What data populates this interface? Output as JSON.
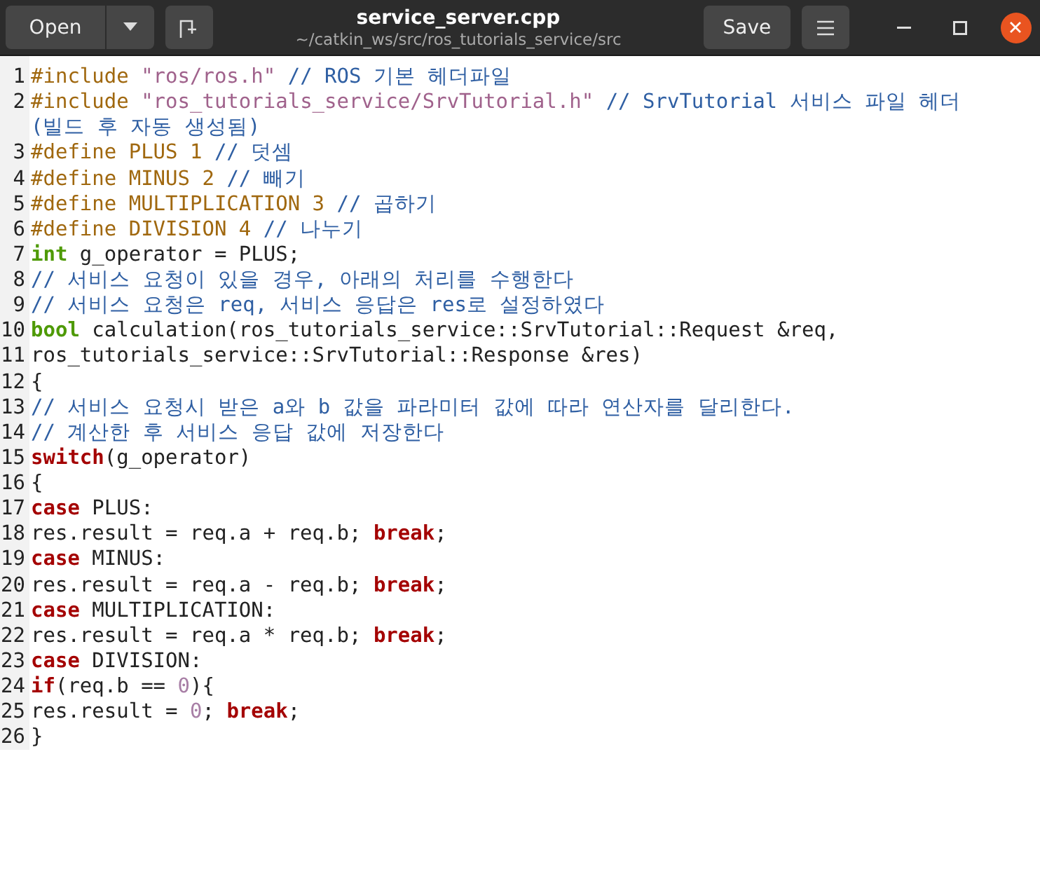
{
  "header": {
    "open_button": "Open",
    "title": "service_server.cpp",
    "subtitle": "~/catkin_ws/src/ros_tutorials_service/src",
    "save_button": "Save"
  },
  "lines": [
    {
      "number": "1",
      "tokens": [
        {
          "kind": "preproc",
          "text": "#include "
        },
        {
          "kind": "string",
          "text": "\"ros/ros.h\""
        },
        {
          "kind": "comment",
          "text": " // ROS 기본 헤더파일"
        }
      ]
    },
    {
      "number": "2",
      "tokens": [
        {
          "kind": "preproc",
          "text": "#include "
        },
        {
          "kind": "string",
          "text": "\"ros_tutorials_service/SrvTutorial.h\""
        },
        {
          "kind": "comment",
          "text": " // SrvTutorial 서비스 파일 헤더 (빌드 후 자동 생성됨)"
        }
      ]
    },
    {
      "number": "3",
      "tokens": [
        {
          "kind": "preproc",
          "text": "#define PLUS 1 "
        },
        {
          "kind": "comment",
          "text": "// 덧셈"
        }
      ]
    },
    {
      "number": "4",
      "tokens": [
        {
          "kind": "preproc",
          "text": "#define MINUS 2 "
        },
        {
          "kind": "comment",
          "text": "// 빼기"
        }
      ]
    },
    {
      "number": "5",
      "tokens": [
        {
          "kind": "preproc",
          "text": "#define MULTIPLICATION 3 "
        },
        {
          "kind": "comment",
          "text": "// 곱하기"
        }
      ]
    },
    {
      "number": "6",
      "tokens": [
        {
          "kind": "preproc",
          "text": "#define DIVISION 4 "
        },
        {
          "kind": "comment",
          "text": "// 나누기"
        }
      ]
    },
    {
      "number": "7",
      "tokens": [
        {
          "kind": "type",
          "text": "int"
        },
        {
          "kind": "plain",
          "text": " g_operator = PLUS;"
        }
      ]
    },
    {
      "number": "8",
      "tokens": [
        {
          "kind": "comment",
          "text": "// 서비스 요청이 있을 경우, 아래의 처리를 수행한다"
        }
      ]
    },
    {
      "number": "9",
      "tokens": [
        {
          "kind": "comment",
          "text": "// 서비스 요청은 req, 서비스 응답은 res로 설정하였다"
        }
      ]
    },
    {
      "number": "10",
      "tokens": [
        {
          "kind": "type",
          "text": "bool"
        },
        {
          "kind": "plain",
          "text": " calculation(ros_tutorials_service::SrvTutorial::Request &req,"
        }
      ]
    },
    {
      "number": "11",
      "tokens": [
        {
          "kind": "plain",
          "text": "ros_tutorials_service::SrvTutorial::Response &res)"
        }
      ]
    },
    {
      "number": "12",
      "tokens": [
        {
          "kind": "plain",
          "text": "{"
        }
      ]
    },
    {
      "number": "13",
      "tokens": [
        {
          "kind": "comment",
          "text": "// 서비스 요청시 받은 a와 b 값을 파라미터 값에 따라 연산자를 달리한다."
        }
      ]
    },
    {
      "number": "14",
      "tokens": [
        {
          "kind": "comment",
          "text": "// 계산한 후 서비스 응답 값에 저장한다"
        }
      ]
    },
    {
      "number": "15",
      "tokens": [
        {
          "kind": "keyword",
          "text": "switch"
        },
        {
          "kind": "plain",
          "text": "(g_operator)"
        }
      ]
    },
    {
      "number": "16",
      "tokens": [
        {
          "kind": "plain",
          "text": "{"
        }
      ]
    },
    {
      "number": "17",
      "tokens": [
        {
          "kind": "keyword",
          "text": "case"
        },
        {
          "kind": "plain",
          "text": " PLUS:"
        }
      ]
    },
    {
      "number": "18",
      "tokens": [
        {
          "kind": "plain",
          "text": "res.result = req.a + req.b; "
        },
        {
          "kind": "keyword",
          "text": "break"
        },
        {
          "kind": "plain",
          "text": ";"
        }
      ]
    },
    {
      "number": "19",
      "tokens": [
        {
          "kind": "keyword",
          "text": "case"
        },
        {
          "kind": "plain",
          "text": " MINUS:"
        }
      ]
    },
    {
      "number": "20",
      "tokens": [
        {
          "kind": "plain",
          "text": "res.result = req.a - req.b; "
        },
        {
          "kind": "keyword",
          "text": "break"
        },
        {
          "kind": "plain",
          "text": ";"
        }
      ]
    },
    {
      "number": "21",
      "tokens": [
        {
          "kind": "keyword",
          "text": "case"
        },
        {
          "kind": "plain",
          "text": " MULTIPLICATION:"
        }
      ]
    },
    {
      "number": "22",
      "tokens": [
        {
          "kind": "plain",
          "text": "res.result = req.a * req.b; "
        },
        {
          "kind": "keyword",
          "text": "break"
        },
        {
          "kind": "plain",
          "text": ";"
        }
      ]
    },
    {
      "number": "23",
      "tokens": [
        {
          "kind": "keyword",
          "text": "case"
        },
        {
          "kind": "plain",
          "text": " DIVISION:"
        }
      ]
    },
    {
      "number": "24",
      "tokens": [
        {
          "kind": "keyword",
          "text": "if"
        },
        {
          "kind": "plain",
          "text": "(req.b == "
        },
        {
          "kind": "number",
          "text": "0"
        },
        {
          "kind": "plain",
          "text": "){"
        }
      ]
    },
    {
      "number": "25",
      "tokens": [
        {
          "kind": "plain",
          "text": "res.result = "
        },
        {
          "kind": "number",
          "text": "0"
        },
        {
          "kind": "plain",
          "text": "; "
        },
        {
          "kind": "keyword",
          "text": "break"
        },
        {
          "kind": "plain",
          "text": ";"
        }
      ]
    },
    {
      "number": "26",
      "tokens": [
        {
          "kind": "plain",
          "text": "}"
        }
      ]
    }
  ]
}
